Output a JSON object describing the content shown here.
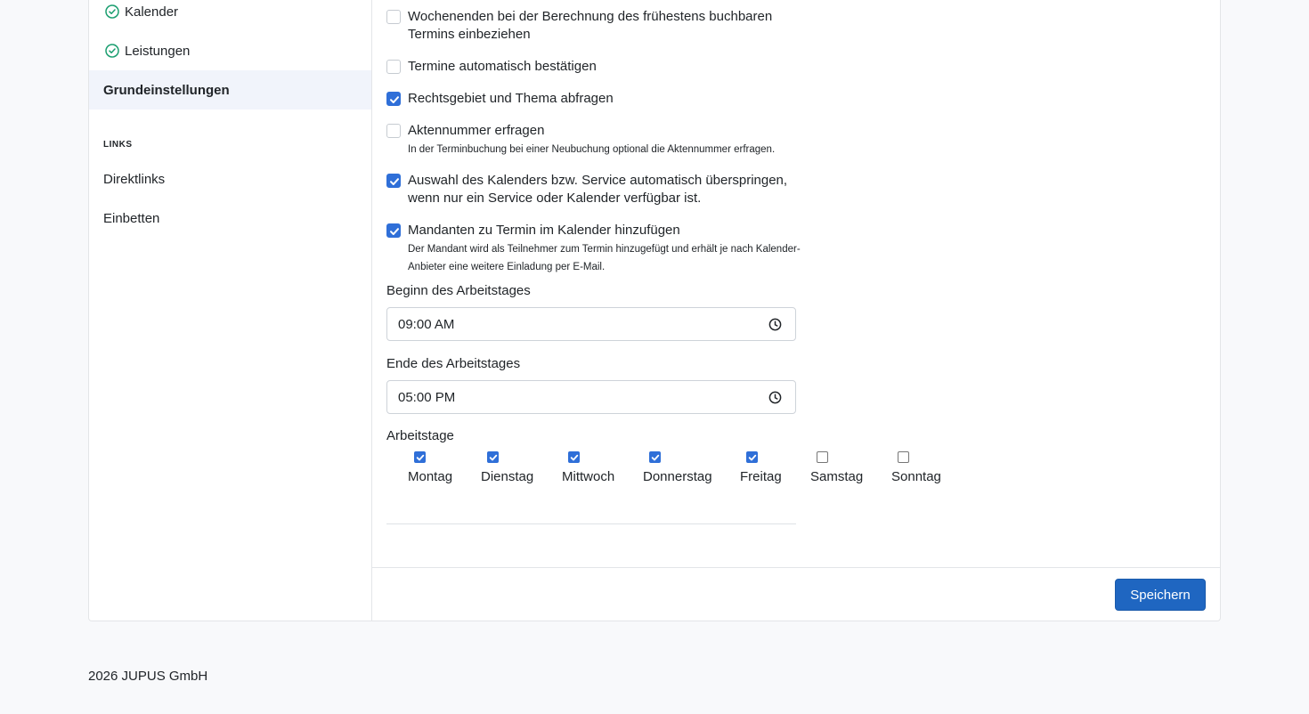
{
  "sidebar": {
    "items_done": [
      {
        "label": "Kalender",
        "icon": "check-circle-icon"
      },
      {
        "label": "Leistungen",
        "icon": "check-circle-icon"
      }
    ],
    "active_item": "Grundeinstellungen",
    "links_section": "LINKS",
    "links": [
      "Direktlinks",
      "Einbetten"
    ]
  },
  "options": [
    {
      "label": "Wochenenden bei der Berechnung des frühestens buchbaren Termins einbeziehen",
      "checked": false,
      "hint": ""
    },
    {
      "label": "Termine automatisch bestätigen",
      "checked": false,
      "hint": ""
    },
    {
      "label": "Rechtsgebiet und Thema abfragen",
      "checked": true,
      "hint": ""
    },
    {
      "label": "Aktennummer erfragen",
      "checked": false,
      "hint": "In der Terminbuchung bei einer Neubuchung optional die Aktennummer erfragen."
    },
    {
      "label": "Auswahl des Kalenders bzw. Service automatisch überspringen, wenn nur ein Service oder Kalender verfügbar ist.",
      "checked": true,
      "hint": ""
    },
    {
      "label": "Mandanten zu Termin im Kalender hinzufügen",
      "checked": true,
      "hint": "Der Mandant wird als Teilnehmer zum Termin hinzugefügt und erhält je nach Kalender-Anbieter eine weitere Einladung per E-Mail."
    }
  ],
  "workday": {
    "start_label": "Beginn des Arbeitstages",
    "start_value": "09:00 AM",
    "end_label": "Ende des Arbeitstages",
    "end_value": "05:00 PM",
    "days_label": "Arbeitstage",
    "days": [
      {
        "label": "Montag",
        "checked": true
      },
      {
        "label": "Dienstag",
        "checked": true
      },
      {
        "label": "Mittwoch",
        "checked": true
      },
      {
        "label": "Donnerstag",
        "checked": true
      },
      {
        "label": "Freitag",
        "checked": true
      },
      {
        "label": "Samstag",
        "checked": false
      },
      {
        "label": "Sonntag",
        "checked": false
      }
    ]
  },
  "save_label": "Speichern",
  "footer": "2026 JUPUS GmbH",
  "colors": {
    "accent": "#2f6fd8",
    "button": "#1f66c1",
    "success": "#1a9e6f"
  }
}
